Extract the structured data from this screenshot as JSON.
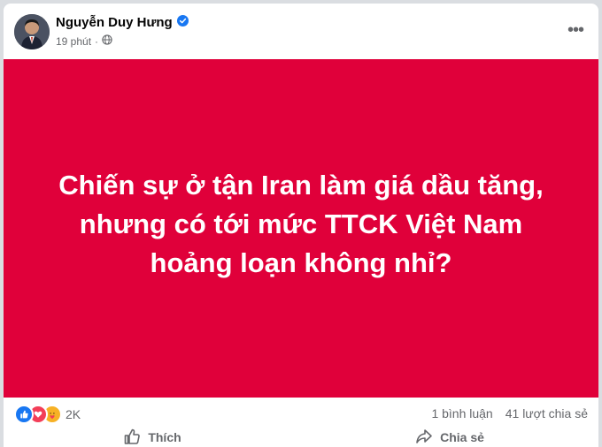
{
  "post": {
    "author": "Nguyễn Duy Hưng",
    "verified": true,
    "time": "19 phút",
    "privacy_icon": "globe-icon",
    "image_text": "Chiến sự ở tận Iran làm giá dầu tăng, nhưng có tới mức TTCK Việt Nam hoảng loạn không nhỉ?",
    "image_bg_color": "#e0003a"
  },
  "stats": {
    "reactions": [
      "like",
      "love",
      "care"
    ],
    "reaction_count": "2K",
    "comments": "1 bình luận",
    "shares": "41 lượt chia sẻ"
  },
  "actions": {
    "like_label": "Thích",
    "share_label": "Chia sẻ"
  },
  "colors": {
    "brand_blue": "#1877f2",
    "secondary_text": "#65676b"
  }
}
